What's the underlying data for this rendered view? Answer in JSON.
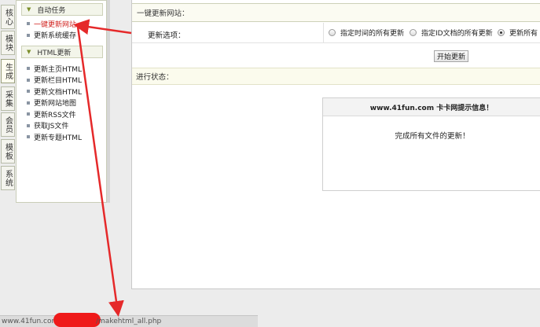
{
  "left_tabs": [
    "核心",
    "模块",
    "生成",
    "采集",
    "会员",
    "模板",
    "系统"
  ],
  "menu": {
    "groups": [
      {
        "title": "自动任务",
        "items": [
          "一键更新网站",
          "更新系统缓存"
        ]
      },
      {
        "title": "HTML更新",
        "items": [
          "更新主页HTML",
          "更新栏目HTML",
          "更新文档HTML",
          "更新网站地图",
          "更新RSS文件",
          "获取JS文件",
          "更新专题HTML"
        ]
      }
    ],
    "active_item": "一键更新网站"
  },
  "main": {
    "section_title": "一键更新网站：",
    "options_label": "更新选项：",
    "radio_options": [
      {
        "label": "指定时间的所有更新",
        "selected": false
      },
      {
        "label": "指定ID文档的所有更新",
        "selected": false
      },
      {
        "label": "更新所有",
        "selected": true
      }
    ],
    "start_button": "开始更新",
    "status_label": "进行状态：",
    "message_box": {
      "title": "www.41fun.com 卡卡网提示信息！",
      "body": "完成所有文件的更新！"
    }
  },
  "statusbar": {
    "url_left": "www.41fun.com",
    "url_right": "/makehtml_all.php"
  },
  "colors": {
    "annotation_red": "#e5292a",
    "accent_green": "#7b8e2a",
    "active_menu": "#d0201c"
  },
  "icons": {
    "group_toggle": "chevron-down-icon",
    "menu_bullet": "square-bullet-icon",
    "annotation": "red-arrow"
  }
}
